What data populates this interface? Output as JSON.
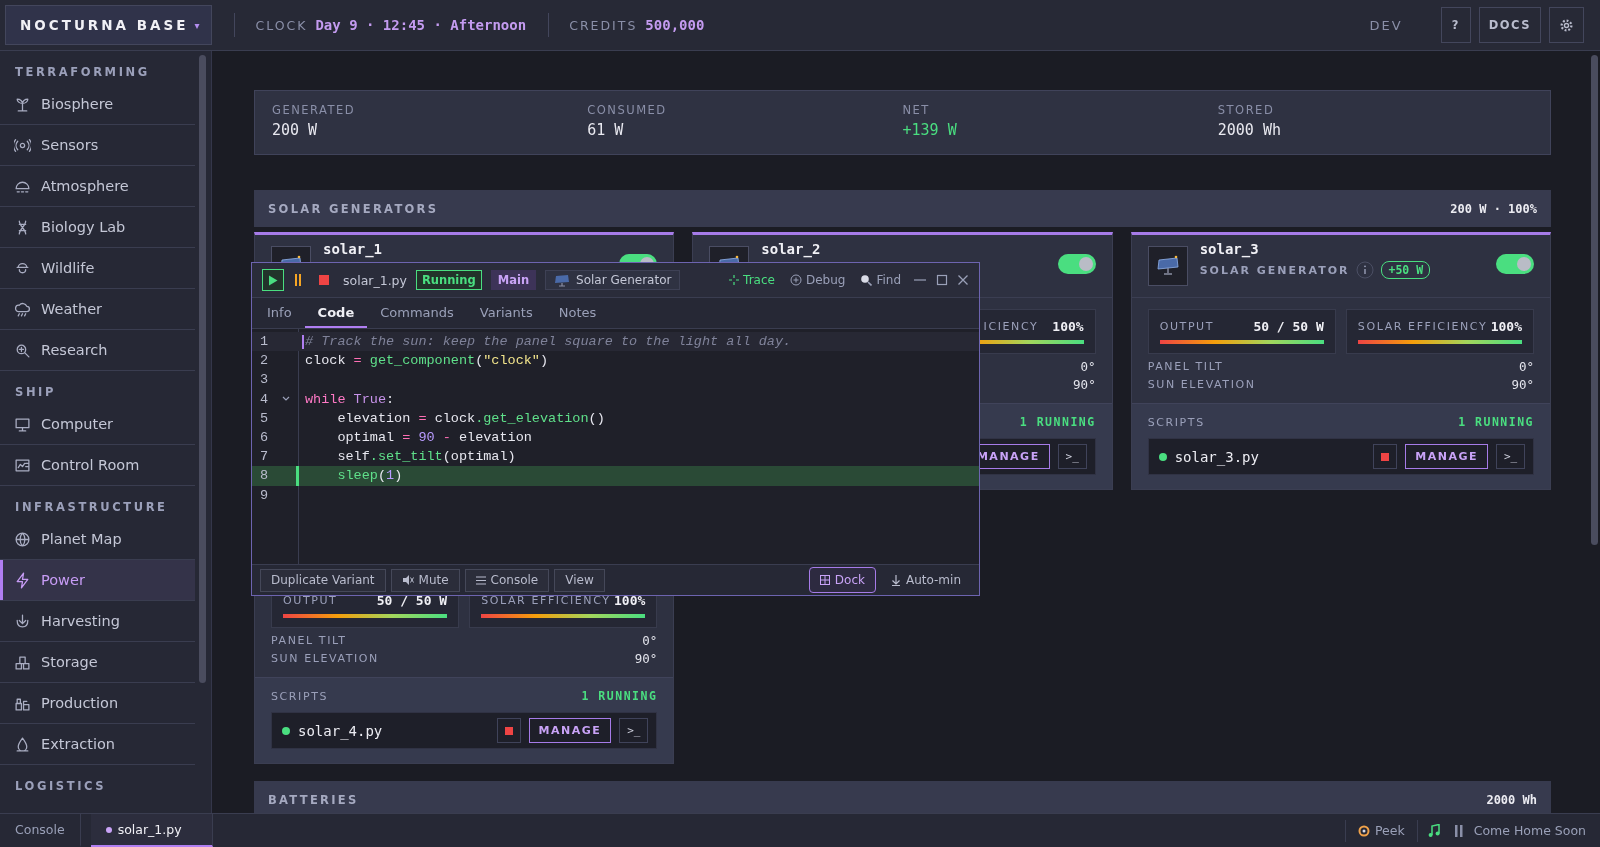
{
  "topbar": {
    "brand": "NOCTURNA BASE",
    "brand_caret": "▾",
    "clock_label": "CLOCK",
    "clock_value": "Day 9 · 12:45 · Afternoon",
    "credits_label": "CREDITS",
    "credits_value": "500,000",
    "mode": "DEV",
    "help": "?",
    "docs": "DOCS"
  },
  "sidebar": {
    "sections": [
      {
        "title": "TERRAFORMING",
        "items": [
          {
            "label": "Biosphere",
            "selected": false
          },
          {
            "label": "Sensors",
            "selected": false
          },
          {
            "label": "Atmosphere",
            "selected": false
          },
          {
            "label": "Biology Lab",
            "selected": false
          },
          {
            "label": "Wildlife",
            "selected": false
          },
          {
            "label": "Weather",
            "selected": false
          },
          {
            "label": "Research",
            "selected": false
          }
        ]
      },
      {
        "title": "SHIP",
        "items": [
          {
            "label": "Computer",
            "selected": false
          },
          {
            "label": "Control Room",
            "selected": false
          }
        ]
      },
      {
        "title": "INFRASTRUCTURE",
        "items": [
          {
            "label": "Planet Map",
            "selected": false
          },
          {
            "label": "Power",
            "selected": true
          },
          {
            "label": "Harvesting",
            "selected": false
          },
          {
            "label": "Storage",
            "selected": false
          },
          {
            "label": "Production",
            "selected": false
          },
          {
            "label": "Extraction",
            "selected": false
          }
        ]
      },
      {
        "title": "LOGISTICS"
      }
    ]
  },
  "stats": [
    {
      "label": "GENERATED",
      "value": "200 W",
      "positive": false
    },
    {
      "label": "CONSUMED",
      "value": "61 W",
      "positive": false
    },
    {
      "label": "NET",
      "value": "+139 W",
      "positive": true
    },
    {
      "label": "STORED",
      "value": "2000 Wh",
      "positive": false
    }
  ],
  "solar_section": {
    "title": "SOLAR GENERATORS",
    "summary": "200 W · 100%",
    "cards": [
      {
        "name": "solar_1",
        "on": true
      },
      {
        "name": "solar_2",
        "on": true,
        "covered_left": true,
        "efficiency": {
          "label": "ICIENCY",
          "value": "100%",
          "level": 1
        },
        "tilt": {
          "value": "0°"
        },
        "elevation": {
          "value": "90°"
        },
        "scripts": {
          "running": "1 RUNNING",
          "manage": "MANAGE",
          "console": ">_"
        }
      },
      {
        "name": "solar_3",
        "type": "SOLAR GENERATOR",
        "badge": "+50 W",
        "on": true,
        "output": {
          "label": "OUTPUT",
          "value": "50 / 50 W",
          "level": 1
        },
        "efficiency": {
          "label": "SOLAR EFFICIENCY",
          "value": "100%",
          "level": 1
        },
        "tilt": {
          "label": "PANEL TILT",
          "value": "0°"
        },
        "elevation": {
          "label": "SUN ELEVATION",
          "value": "90°"
        },
        "scripts": {
          "label": "SCRIPTS",
          "running": "1 RUNNING",
          "file": "solar_3.py",
          "manage": "MANAGE",
          "console": ">_"
        }
      },
      {
        "output": {
          "label": "OUTPUT",
          "value": "50 / 50 W",
          "level": 1
        },
        "efficiency": {
          "label": "SOLAR EFFICIENCY",
          "value": "100%",
          "level": 1
        },
        "tilt": {
          "label": "PANEL TILT",
          "value": "0°"
        },
        "elevation": {
          "label": "SUN ELEVATION",
          "value": "90°"
        },
        "scripts": {
          "label": "SCRIPTS",
          "running": "1 RUNNING",
          "file": "solar_4.py",
          "manage": "MANAGE",
          "console": ">_"
        }
      }
    ]
  },
  "batteries_section": {
    "title": "BATTERIES",
    "summary": "2000 Wh"
  },
  "script_window": {
    "file": "solar_1.py",
    "status": "Running",
    "variant": "Main",
    "component": "Solar Generator",
    "actions": [
      {
        "label": "Trace",
        "kind": "trace"
      },
      {
        "label": "Debug",
        "kind": "debug"
      },
      {
        "label": "Find",
        "kind": "find"
      }
    ],
    "tabs": [
      {
        "label": "Info",
        "selected": false
      },
      {
        "label": "Code",
        "selected": true
      },
      {
        "label": "Commands",
        "selected": false
      },
      {
        "label": "Variants",
        "selected": false
      },
      {
        "label": "Notes",
        "selected": false
      }
    ],
    "lines": [
      {
        "number": "1",
        "cursor": true,
        "current": false,
        "foldable": false,
        "tokens": [
          {
            "kind": "comment",
            "text": "# Track the sun: keep the panel square to the light all day."
          }
        ]
      },
      {
        "number": "2",
        "cursor": false,
        "current": false,
        "foldable": false,
        "tokens": [
          {
            "kind": "plain",
            "text": "clock "
          },
          {
            "kind": "op",
            "text": "= "
          },
          {
            "kind": "func",
            "text": "get_component"
          },
          {
            "kind": "plain",
            "text": "("
          },
          {
            "kind": "string",
            "text": "\"clock\""
          },
          {
            "kind": "plain",
            "text": ")"
          }
        ]
      },
      {
        "number": "3",
        "cursor": false,
        "current": false,
        "foldable": false
      },
      {
        "number": "4",
        "cursor": false,
        "current": false,
        "foldable": true,
        "tokens": [
          {
            "kind": "keyword",
            "text": "while "
          },
          {
            "kind": "const",
            "text": "True"
          },
          {
            "kind": "plain",
            "text": ":"
          }
        ]
      },
      {
        "number": "5",
        "cursor": false,
        "current": false,
        "foldable": false,
        "tokens": [
          {
            "kind": "plain",
            "text": "    elevation "
          },
          {
            "kind": "op",
            "text": "="
          },
          {
            "kind": "plain",
            "text": " clock"
          },
          {
            "kind": "func",
            "text": ".get_elevation"
          },
          {
            "kind": "plain",
            "text": "()"
          }
        ]
      },
      {
        "number": "6",
        "cursor": false,
        "current": false,
        "foldable": false,
        "tokens": [
          {
            "kind": "plain",
            "text": "    optimal "
          },
          {
            "kind": "op",
            "text": "= "
          },
          {
            "kind": "number",
            "text": "90"
          },
          {
            "kind": "op",
            "text": " - "
          },
          {
            "kind": "plain",
            "text": "elevation"
          }
        ]
      },
      {
        "number": "7",
        "cursor": false,
        "current": false,
        "foldable": false,
        "tokens": [
          {
            "kind": "plain",
            "text": "    self"
          },
          {
            "kind": "func",
            "text": ".set_tilt"
          },
          {
            "kind": "plain",
            "text": "(optimal)"
          }
        ]
      },
      {
        "number": "8",
        "cursor": false,
        "current": true,
        "foldable": false,
        "tokens": [
          {
            "kind": "func",
            "text": "    sleep"
          },
          {
            "kind": "plain",
            "text": "("
          },
          {
            "kind": "number",
            "text": "1"
          },
          {
            "kind": "plain",
            "text": ")"
          }
        ]
      },
      {
        "number": "9",
        "cursor": false,
        "current": false,
        "foldable": false
      }
    ],
    "footer_buttons": [
      {
        "label": "Duplicate Variant",
        "kind": "plain"
      },
      {
        "label": "Mute",
        "kind": "mute"
      },
      {
        "label": "Console",
        "kind": "console"
      },
      {
        "label": "View",
        "kind": "plain"
      }
    ],
    "dock": {
      "label": "Dock",
      "selected": true
    },
    "auto_min": "Auto-min"
  },
  "bottom_bar": {
    "tabs": [
      {
        "label": "Console",
        "selected": false
      },
      {
        "label": "solar_1.py",
        "selected": true
      }
    ],
    "peek": "Peek",
    "track": "Come Home Soon"
  }
}
